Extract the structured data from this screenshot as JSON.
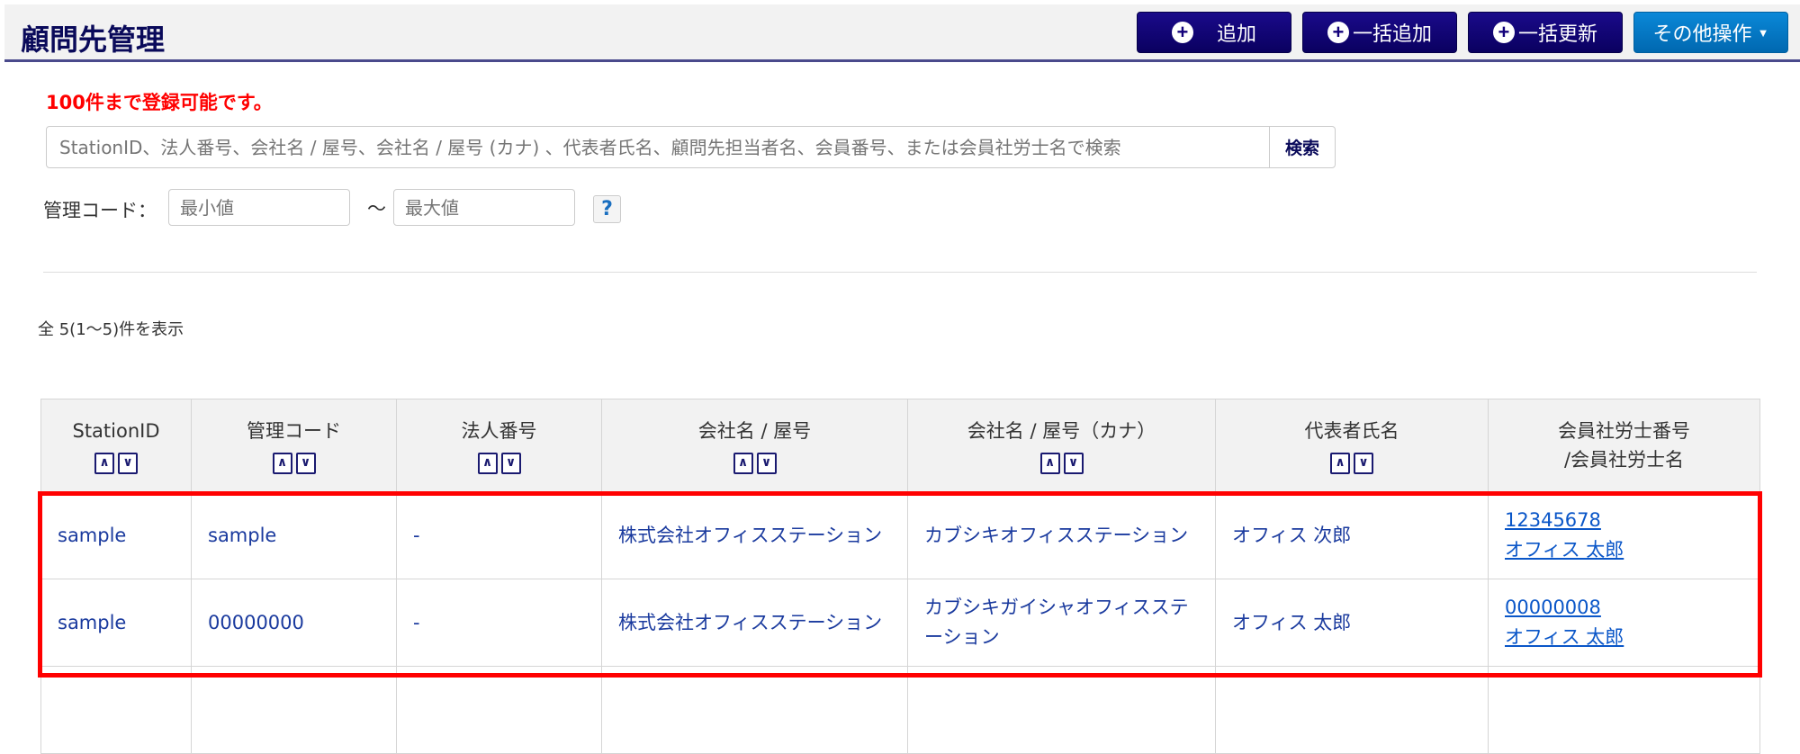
{
  "header": {
    "title": "顧問先管理",
    "buttons": {
      "add": "追加",
      "bulk_add": "一括追加",
      "bulk_update": "一括更新",
      "other": "その他操作"
    }
  },
  "notice": "100件まで登録可能です。",
  "search": {
    "placeholder": "StationID、法人番号、会社名 / 屋号、会社名 / 屋号 (カナ) 、代表者氏名、顧問先担当者名、会員番号、または会員社労士名で検索",
    "button": "検索"
  },
  "code_filter": {
    "label": "管理コード：",
    "min_placeholder": "最小値",
    "max_placeholder": "最大値",
    "separator": "～",
    "help": "?"
  },
  "result_count": "全 5(1～5)件を表示",
  "table": {
    "headers": [
      "StationID",
      "管理コード",
      "法人番号",
      "会社名 / 屋号",
      "会社名 / 屋号（カナ）",
      "代表者氏名",
      "会員社労士番号",
      "/会員社労士名"
    ],
    "sort_up": "∧",
    "sort_down": "∨",
    "rows": [
      {
        "station_id": "sample",
        "code": "sample",
        "corp_no": "-",
        "company": "株式会社オフィスステーション",
        "kana": "カブシキオフィスステーション",
        "rep": "オフィス 次郎",
        "member_no": "12345678",
        "member_name": "オフィス 太郎"
      },
      {
        "station_id": "sample",
        "code": "00000000",
        "corp_no": "-",
        "company": "株式会社オフィスステーション",
        "kana": "カブシキガイシャオフィスステーション",
        "rep": "オフィス 太郎",
        "member_no": "00000008",
        "member_name": "オフィス 太郎"
      }
    ]
  }
}
